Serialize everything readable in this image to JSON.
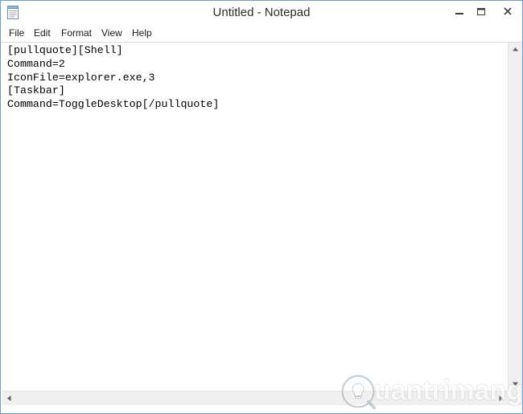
{
  "window": {
    "title": "Untitled - Notepad"
  },
  "menu": {
    "items": [
      {
        "label": "File"
      },
      {
        "label": "Edit"
      },
      {
        "label": "Format"
      },
      {
        "label": "View"
      },
      {
        "label": "Help"
      }
    ]
  },
  "editor": {
    "lines": [
      "[pullquote][Shell]",
      "Command=2",
      "IconFile=explorer.exe,3",
      "[Taskbar]",
      "Command=ToggleDesktop[/pullquote]"
    ]
  },
  "watermark": {
    "text": "uantrimang"
  },
  "icons": {
    "app": "notepad-icon",
    "minimize": "minimize-icon",
    "maximize": "maximize-icon",
    "close": "close-icon",
    "logo": "quantrimang-logo-icon"
  },
  "colors": {
    "window_border": "#6b9fd3",
    "scrollbar_track": "#f0f0f0",
    "text": "#000000"
  }
}
